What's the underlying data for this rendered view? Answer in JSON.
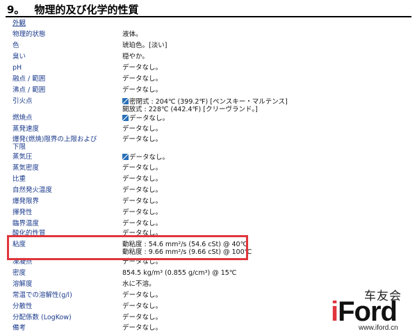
{
  "section": {
    "number": "9。",
    "title": "物理的及び化学的性質"
  },
  "rows": [
    {
      "label": "外観",
      "value": ""
    },
    {
      "label": "物理的状態",
      "value": "液体。"
    },
    {
      "label": "色",
      "value": "琥珀色。[淡い]"
    },
    {
      "label": "臭い",
      "value": "穏やか。"
    },
    {
      "label": "pH",
      "value": "データなし。"
    },
    {
      "label": "融点 / 範囲",
      "value": "データなし。"
    },
    {
      "label": "沸点 / 範囲",
      "value": "データなし。"
    },
    {
      "label": "引火点",
      "value": "密閉式 : 204℃ (399.2℉) [ペンスキー・マルテンス]",
      "value2": "開放式 : 228℃ (442.4℉) [クリーヴランド。]"
    },
    {
      "label": "燃焼点",
      "value": "データなし。"
    },
    {
      "label": "蒸発速度",
      "value": "データなし。"
    },
    {
      "label": "爆発(燃焼)限界の上限および",
      "label2": "下限",
      "value": "データなし。"
    },
    {
      "label": "蒸気圧",
      "value": "データなし。"
    },
    {
      "label": "蒸気密度",
      "value": "データなし。"
    },
    {
      "label": "比重",
      "value": "データなし。"
    },
    {
      "label": "自然発火温度",
      "value": "データなし。"
    },
    {
      "label": "爆発限界",
      "value": "データなし。"
    },
    {
      "label": "揮発性",
      "value": "データなし。"
    },
    {
      "label": "臨界温度",
      "value": "データなし。"
    },
    {
      "label": "酸化的性質",
      "value": "データなし。"
    },
    {
      "label": "粘度",
      "value": "動粘度 : 54.6 mm²/s (54.6 cSt) @ 40℃",
      "value2": "動粘度 : 9.66 mm²/s (9.66 cSt) @ 100℃"
    },
    {
      "label": "凍凝点",
      "value": "データなし。"
    },
    {
      "label": "密度",
      "value": "854.5 kg/m³ (0.855 g/cm³) @ 15℃"
    },
    {
      "label": "溶解度",
      "value": "水に不溶。"
    },
    {
      "label": "常温での溶解性(g/l)",
      "value": "データなし。"
    },
    {
      "label": "分散性",
      "value": "データなし。"
    },
    {
      "label": "分配係数 (LogKow)",
      "value": "データなし。"
    },
    {
      "label": "備考",
      "value": "データなし。"
    }
  ],
  "watermark": {
    "cn": "车友会",
    "brand_i": "i",
    "brand_rest": "Ford",
    "url": "www.iford.cn"
  },
  "colors": {
    "label": "#1a3a8c",
    "highlight": "#e0353b",
    "logo_accent": "#e0353b"
  }
}
